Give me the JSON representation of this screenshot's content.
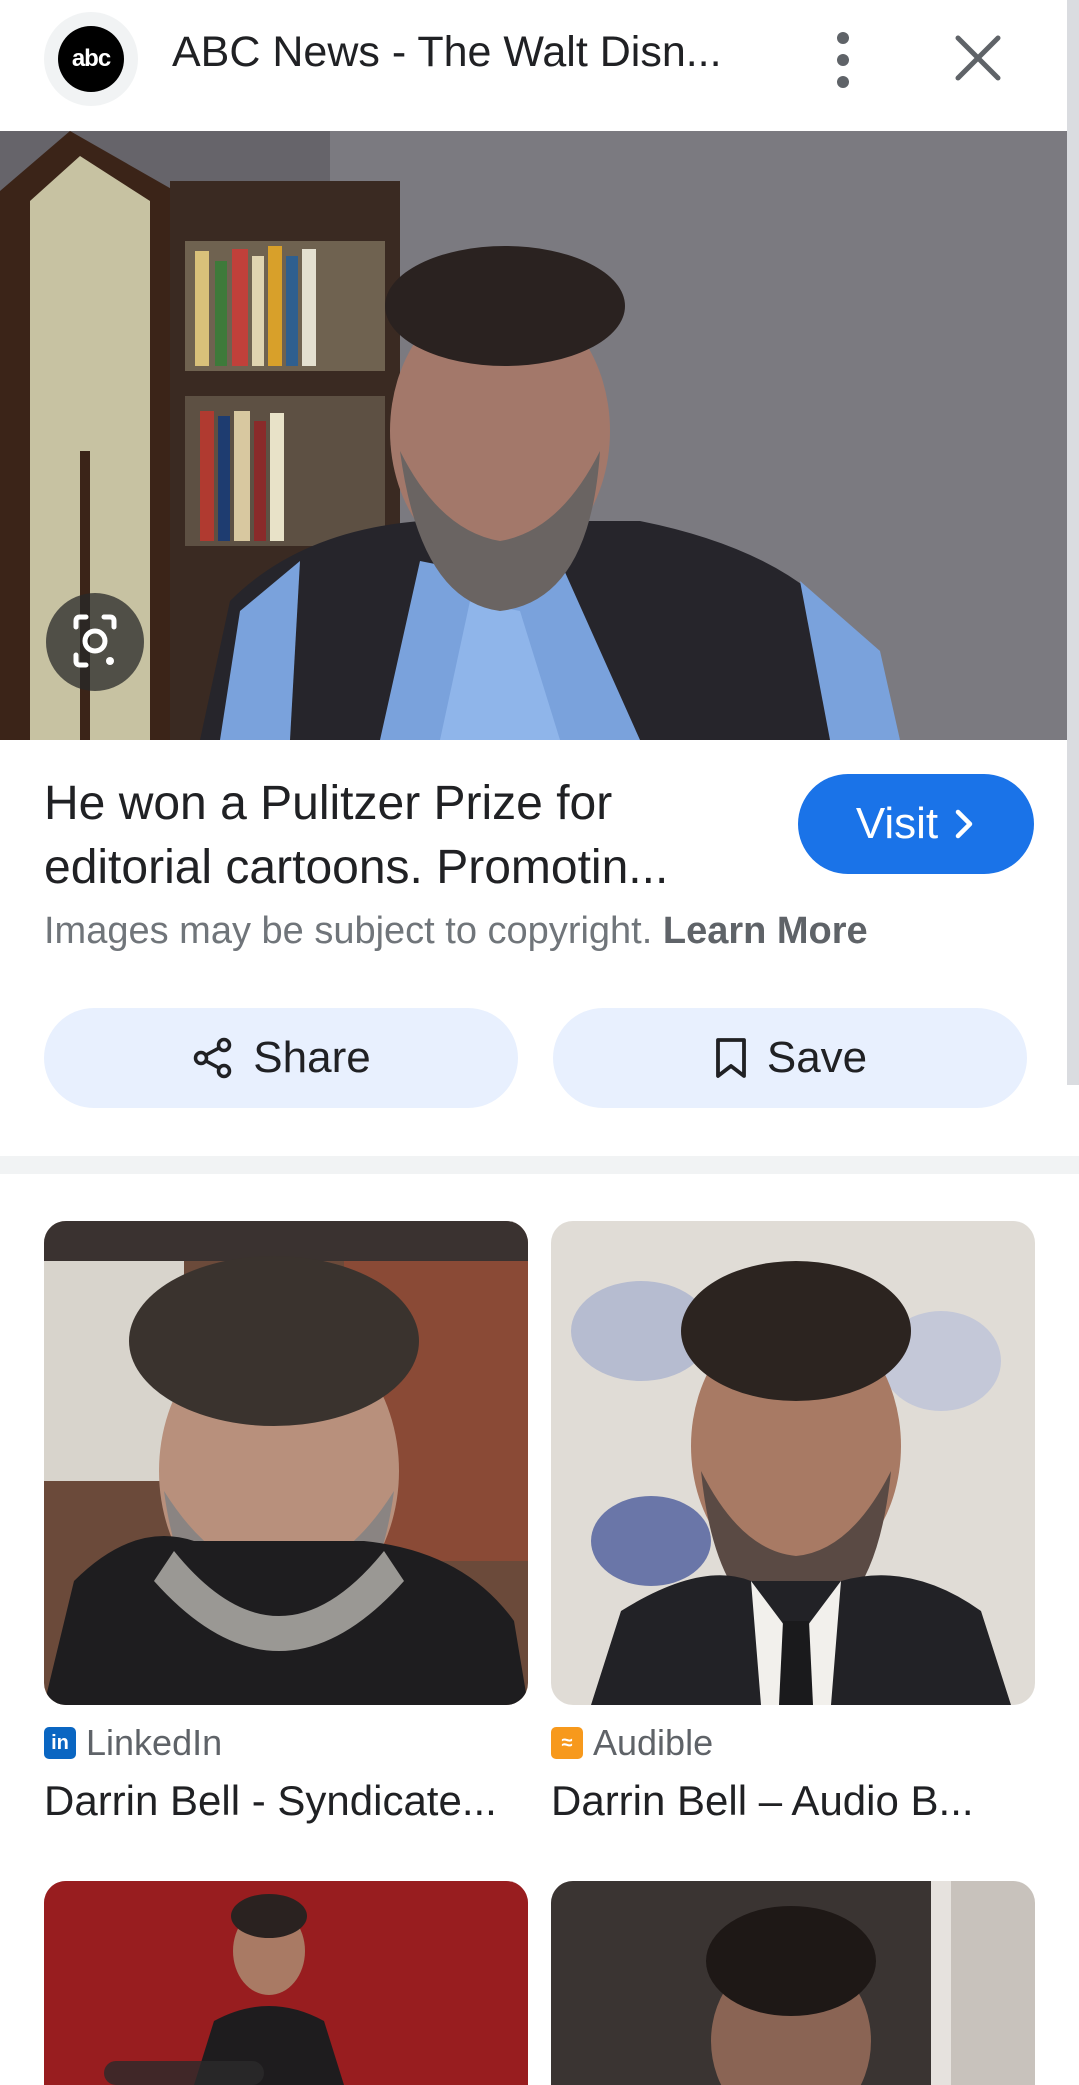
{
  "header": {
    "logo_text": "abc",
    "title": "ABC News - The Walt Disn...",
    "more_icon": "more-vert-icon",
    "close_icon": "close-icon"
  },
  "hero": {
    "lens_icon": "lens-camera-icon"
  },
  "result": {
    "title": "He won a Pulitzer Prize for editorial cartoons. Promotin...",
    "visit_label": "Visit",
    "copyright_text": "Images may be subject to copyright.",
    "learn_more": "Learn More",
    "share_label": "Share",
    "save_label": "Save"
  },
  "related": [
    {
      "source": "LinkedIn",
      "title": "Darrin Bell - Syndicate...",
      "source_color": "#0a66c2",
      "source_icon": "linkedin-icon"
    },
    {
      "source": "Audible",
      "title": "Darrin Bell – Audio B...",
      "source_color": "#f7991c",
      "source_icon": "audible-icon"
    }
  ],
  "colors": {
    "accent": "#1a73e8",
    "pill_bg": "#e8f0fe",
    "text_primary": "#202124",
    "text_secondary": "#70757a"
  }
}
